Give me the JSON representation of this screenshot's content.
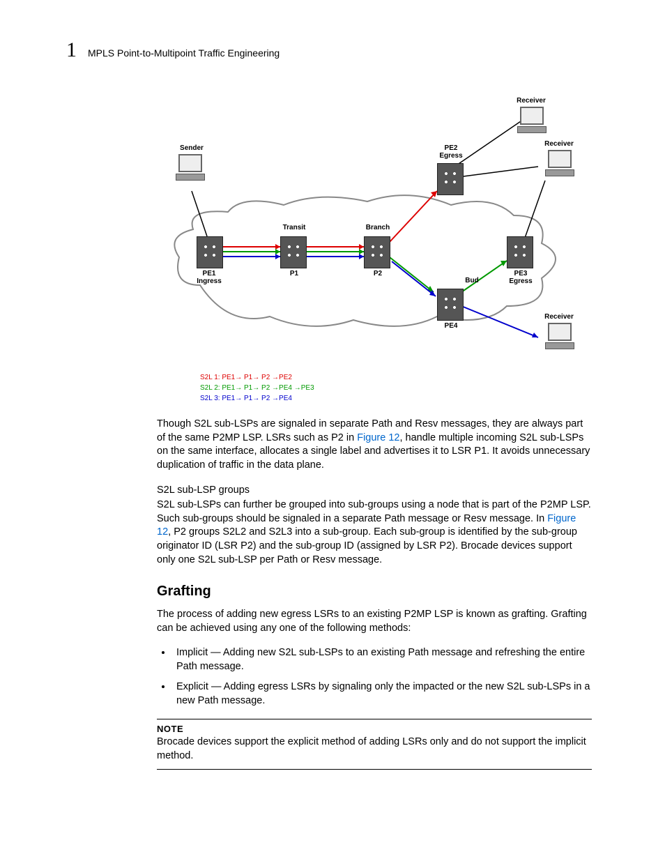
{
  "header": {
    "chapter_number": "1",
    "chapter_title": "MPLS Point-to-Multipoint Traffic Engineering"
  },
  "diagram": {
    "nodes": {
      "sender": "Sender",
      "pe1": "PE1\nIngress",
      "p1_transit": "Transit",
      "p1": "P1",
      "p2_branch": "Branch",
      "p2": "P2",
      "pe2_egress": "PE2\nEgress",
      "pe3_egress": "PE3\nEgress",
      "pe4_bud": "Bud",
      "pe4": "PE4",
      "receiver1": "Receiver",
      "receiver2": "Receiver",
      "receiver3": "Receiver"
    },
    "legend": {
      "s2l1": "S2L 1: PE1 → P1 → P2 → PE2",
      "s2l2": "S2L 2: PE1 → P1 → P2 → PE4 → PE3",
      "s2l3": "S2L 3: PE1 → P1 → P2 → PE4"
    }
  },
  "paragraphs": {
    "p1a": "Though S2L sub-LSPs are signaled in separate Path and Resv messages, they are always part of the same P2MP LSP. LSRs such as P2 in ",
    "p1_link": "Figure 12",
    "p1b": ", handle multiple incoming S2L sub-LSPs on the same interface, allocates a single label and advertises it to LSR P1. It avoids unnecessary duplication of traffic in the data plane.",
    "sub_heading": "S2L sub-LSP groups",
    "p2a": "S2L sub-LSPs can further be grouped into sub-groups using a node that is part of the P2MP LSP. Such sub-groups should be signaled in a separate Path message or Resv message. In ",
    "p2_link": "Figure 12",
    "p2b": ", P2 groups S2L2 and S2L3 into a sub-group. Each sub-group is identified by the sub-group originator ID (LSR P2) and the sub-group ID (assigned by LSR P2). Brocade devices support only one S2L sub-LSP per Path or Resv message.",
    "section_heading": "Grafting",
    "p3": "The process of adding new egress LSRs to an existing P2MP LSP is known as grafting. Grafting can be achieved using any one of the following methods:",
    "bullet1": "Implicit — Adding new S2L sub-LSPs to an existing Path message and refreshing the entire Path message.",
    "bullet2": "Explicit — Adding egress LSRs by signaling only the impacted or the new S2L sub-LSPs in a new Path message.",
    "note_label": "NOTE",
    "note_text": "Brocade devices support the explicit method of adding LSRs only and do not support the implicit method."
  }
}
